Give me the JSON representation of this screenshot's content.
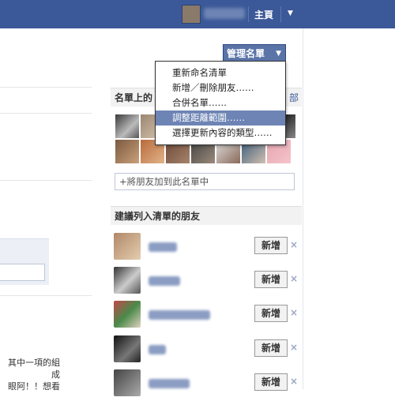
{
  "topbar": {
    "home_label": "主頁",
    "account_arrow": "▼"
  },
  "manage_button": {
    "label": "管理名單",
    "caret": "▼"
  },
  "menu": {
    "items": [
      {
        "label": "重新命名清單",
        "highlighted": false
      },
      {
        "label": "新增／刪除朋友……",
        "highlighted": false
      },
      {
        "label": "合併名單……",
        "highlighted": false
      },
      {
        "label": "調整距離範圍……",
        "highlighted": true
      },
      {
        "label": "選擇更新內容的類型……",
        "highlighted": false
      }
    ]
  },
  "members_section": {
    "title": "名單上的",
    "more_link": "部"
  },
  "add_friend_input": {
    "placeholder": "+將朋友加到此名單中"
  },
  "suggested_section": {
    "title": "建議列入清單的朋友"
  },
  "suggestions": [
    {
      "add_label": "新增",
      "dismiss": "×"
    },
    {
      "add_label": "新增",
      "dismiss": "×"
    },
    {
      "add_label": "新增",
      "dismiss": "×"
    },
    {
      "add_label": "新增",
      "dismiss": "×"
    },
    {
      "add_label": "新增",
      "dismiss": "×"
    }
  ],
  "left_note": {
    "line1": "其中一項的組成",
    "line2": "眼阿！！想看"
  },
  "colors": {
    "topbar": "#3b5998",
    "highlight": "#6d84b4",
    "button": "#5b74a8"
  }
}
